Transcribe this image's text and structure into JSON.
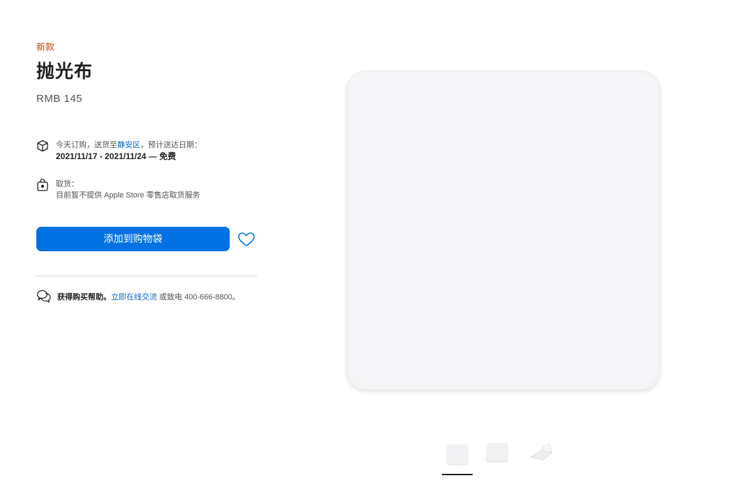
{
  "product": {
    "badge": "新款",
    "title": "抛光布",
    "price": "RMB 145"
  },
  "delivery": {
    "icon": "package-icon",
    "line1_prefix": "今天订购，送货至",
    "location": "静安区",
    "line1_suffix": "，预计送达日期：",
    "dates": "2021/11/17 - 2021/11/24 — 免费"
  },
  "pickup": {
    "icon": "store-bag-icon",
    "label": "取货：",
    "detail": "目前暂不提供 Apple Store 零售店取货服务"
  },
  "actions": {
    "add_to_bag": "添加到购物袋",
    "favorite_icon": "heart-icon"
  },
  "help": {
    "icon": "chat-bubbles-icon",
    "prefix": "获得购买帮助。",
    "link": "立即在线交流",
    "suffix": " 或致电 400-666-8800。"
  },
  "gallery": {
    "thumbnails": [
      "thumbnail-front",
      "thumbnail-flat",
      "thumbnail-folded"
    ],
    "selected_index": 0
  },
  "colors": {
    "badge": "#bf4800",
    "accent": "#0071e3",
    "link": "#0066cc"
  }
}
